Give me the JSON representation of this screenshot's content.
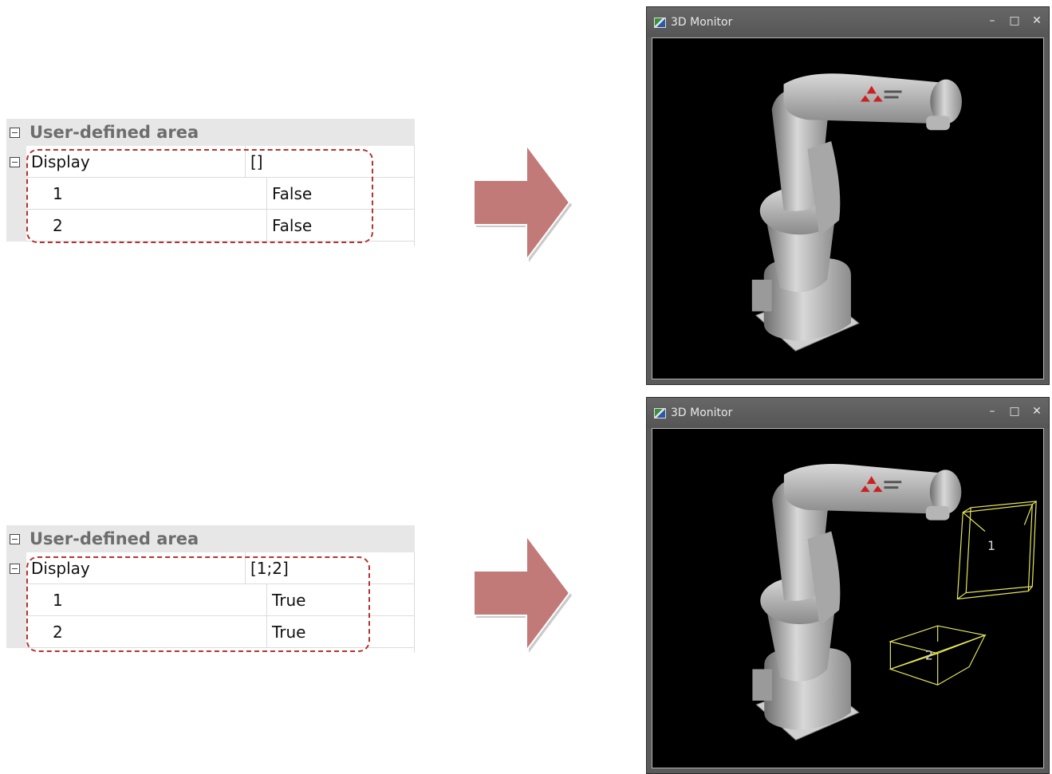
{
  "panels": [
    {
      "section_title": "User-defined area",
      "display_label": "Display",
      "display_value": "[]",
      "items": [
        {
          "label": "1",
          "value": "False"
        },
        {
          "label": "2",
          "value": "False"
        }
      ],
      "monitor": {
        "title": "3D Monitor",
        "boxes": []
      }
    },
    {
      "section_title": "User-defined area",
      "display_label": "Display",
      "display_value": "[1;2]",
      "items": [
        {
          "label": "1",
          "value": "True"
        },
        {
          "label": "2",
          "value": "True"
        }
      ],
      "monitor": {
        "title": "3D Monitor",
        "boxes": [
          "1",
          "2"
        ]
      }
    }
  ],
  "window_controls": {
    "minimize": "–",
    "maximize": "□",
    "close": "✕"
  },
  "colors": {
    "arrow": "#c27a78",
    "dashed_highlight": "#b5322f",
    "area_box": "#e8e85a",
    "viewport_bg": "#000000"
  }
}
